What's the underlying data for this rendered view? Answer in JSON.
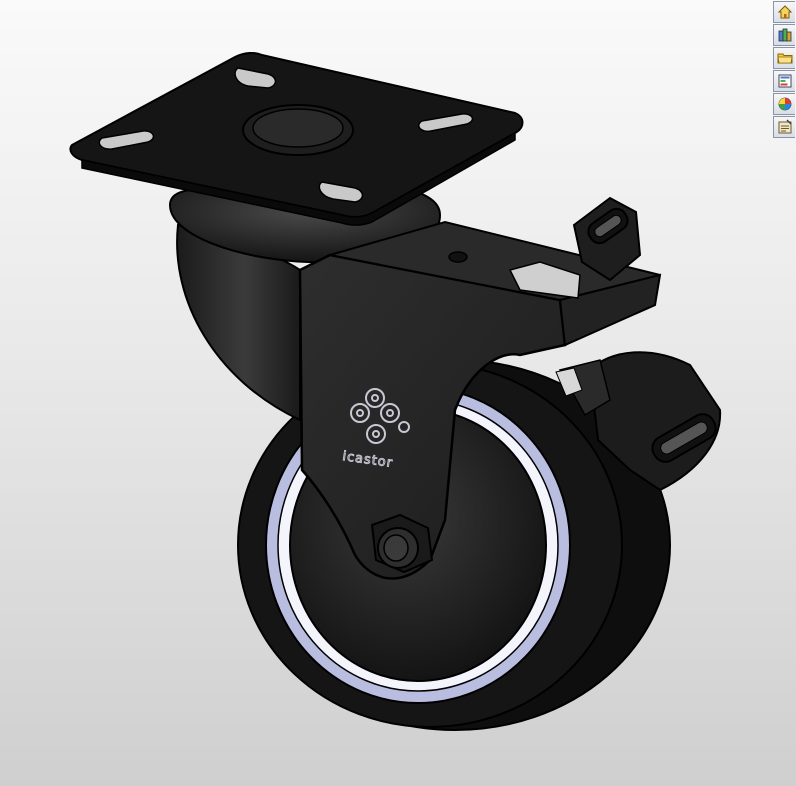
{
  "viewport": {
    "background_top": "#fafafa",
    "background_bottom": "#cfcfcf",
    "model": {
      "brand_text": "icastor",
      "body_color": "#1c1c1c",
      "edge_color": "#000000",
      "tread_band_color": "#b9bde0"
    }
  },
  "task_pane": {
    "tabs": [
      {
        "icon": "home-icon"
      },
      {
        "icon": "design-library-icon"
      },
      {
        "icon": "file-explorer-icon"
      },
      {
        "icon": "view-palette-icon"
      },
      {
        "icon": "appearances-icon"
      },
      {
        "icon": "custom-properties-icon"
      }
    ]
  }
}
